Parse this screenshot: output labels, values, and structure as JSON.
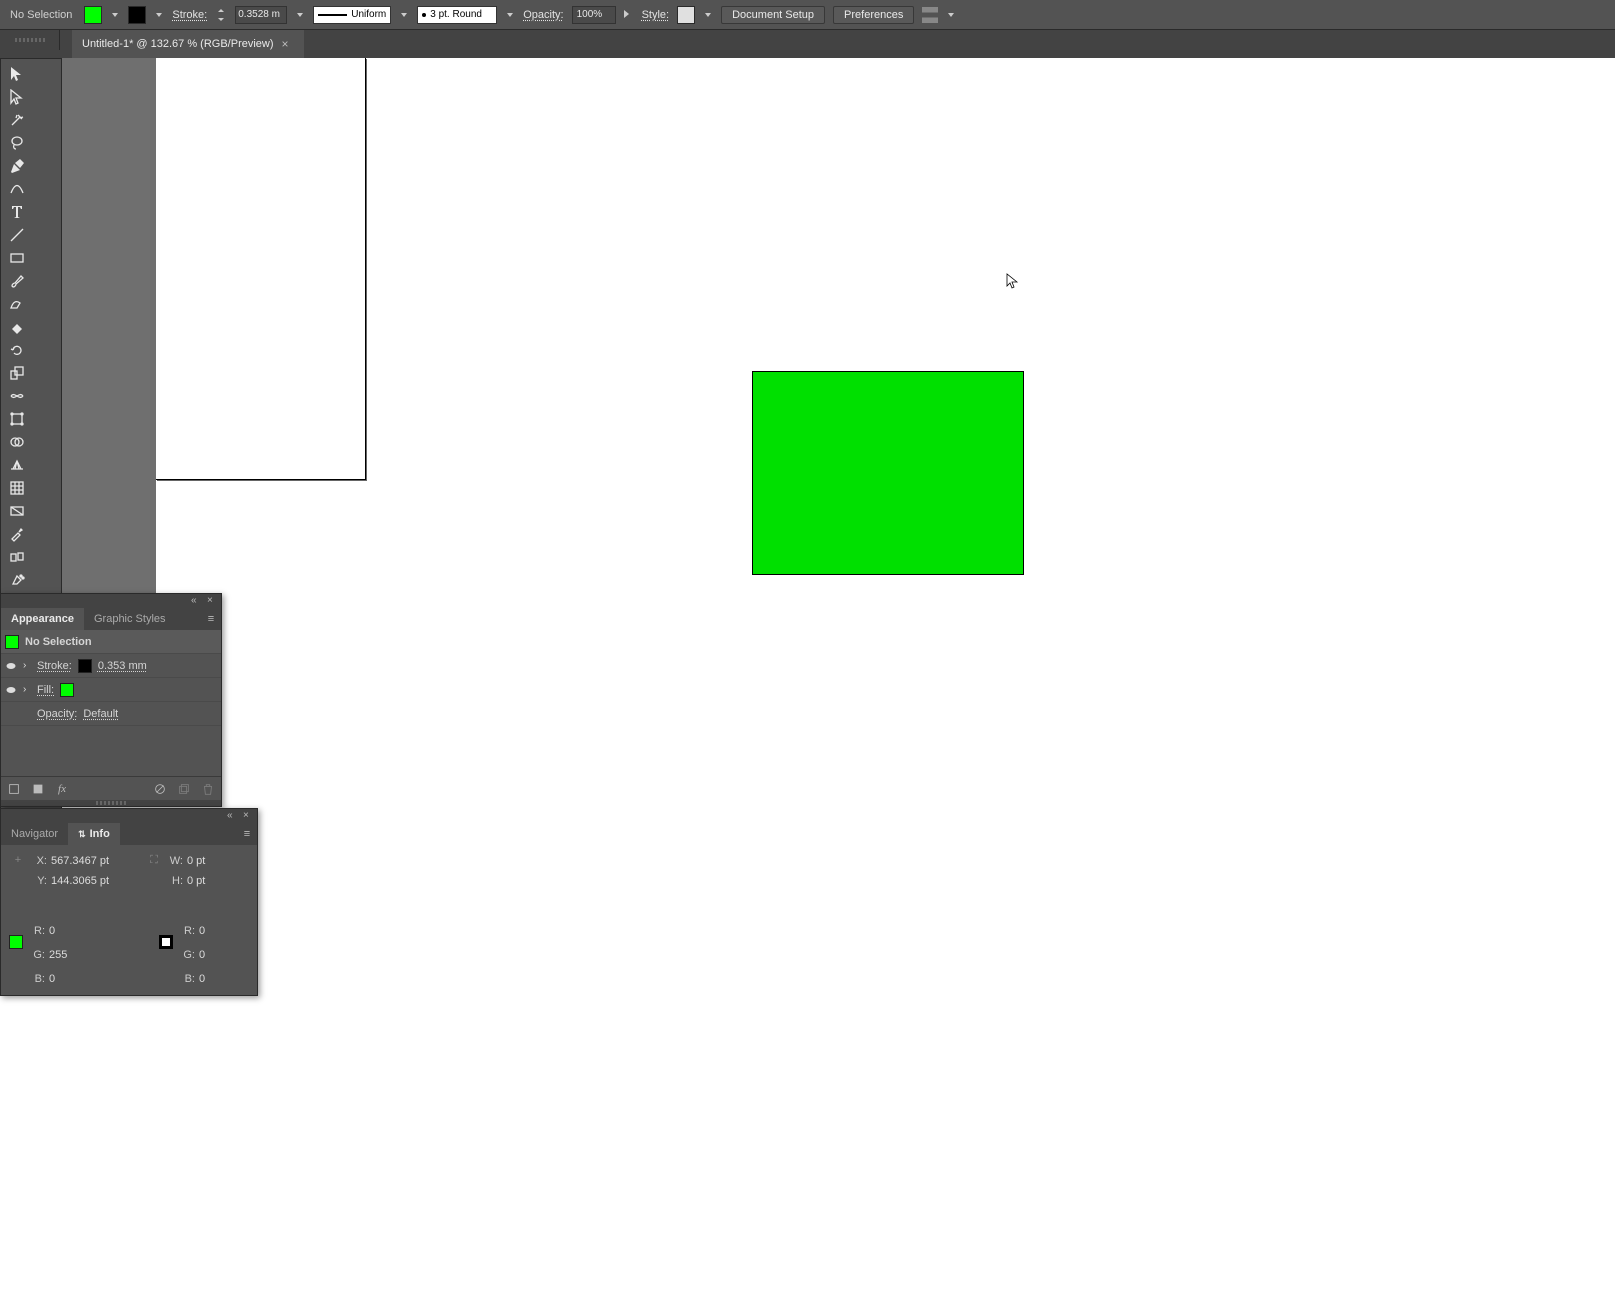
{
  "optbar": {
    "selection_status": "No Selection",
    "fill_color": "#00ff00",
    "stroke_color": "#000000",
    "stroke_label": "Stroke:",
    "stroke_value": "0.3528 m",
    "stroke_type": "Uniform",
    "brush_label": "3 pt. Round",
    "opacity_label": "Opacity:",
    "opacity_value": "100%",
    "style_label": "Style:",
    "doc_setup": "Document Setup",
    "preferences": "Preferences"
  },
  "tab": {
    "title": "Untitled-1* @ 132.67 % (RGB/Preview)"
  },
  "appearance": {
    "tab1": "Appearance",
    "tab2": "Graphic Styles",
    "title": "No Selection",
    "stroke_label": "Stroke:",
    "stroke_value": "0.353 mm",
    "fill_label": "Fill:",
    "opacity_label": "Opacity:",
    "opacity_value": "Default"
  },
  "info": {
    "tab1": "Navigator",
    "tab2": "Info",
    "x_label": "X:",
    "x_value": "567.3467 pt",
    "y_label": "Y:",
    "y_value": "144.3065 pt",
    "w_label": "W:",
    "w_value": "0 pt",
    "h_label": "H:",
    "h_value": "0 pt",
    "fill_r": "0",
    "fill_g": "255",
    "fill_b": "0",
    "stroke_r": "0",
    "stroke_g": "0",
    "stroke_b": "0"
  },
  "canvas": {
    "rect_fill": "#00e000",
    "rect_stroke": "#000000"
  }
}
